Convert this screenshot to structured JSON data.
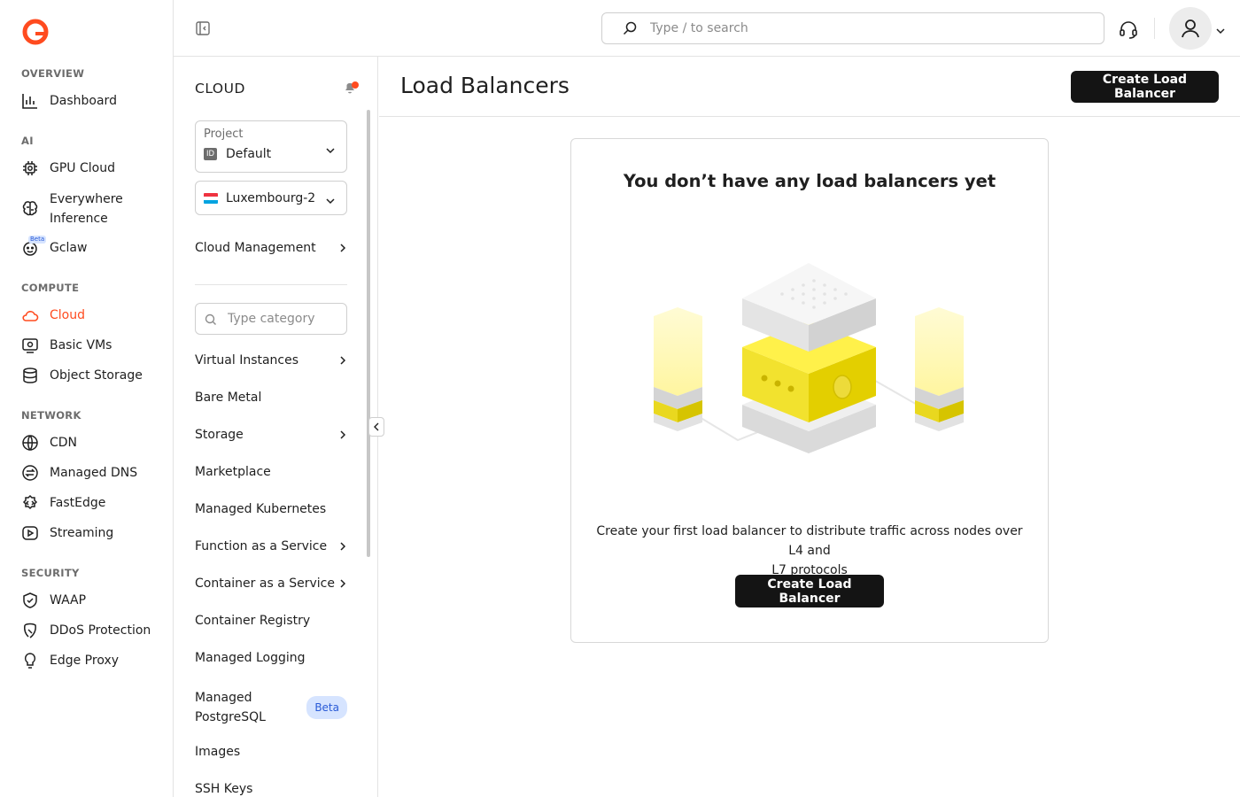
{
  "leftnav": {
    "sections": {
      "overview": "OVERVIEW",
      "ai": "AI",
      "compute": "COMPUTE",
      "network": "NETWORK",
      "security": "SECURITY"
    },
    "items": {
      "dashboard": "Dashboard",
      "gpu_cloud": "GPU Cloud",
      "everywhere_1": "Everywhere",
      "everywhere_2": "Inference",
      "gclaw": "Gclaw",
      "gclaw_badge": "Beta",
      "cloud": "Cloud",
      "basic_vms": "Basic VMs",
      "object_storage": "Object Storage",
      "cdn": "CDN",
      "managed_dns": "Managed DNS",
      "fastedge": "FastEdge",
      "streaming": "Streaming",
      "waap": "WAAP",
      "ddos": "DDoS Protection",
      "edge_proxy": "Edge Proxy"
    },
    "accent_color": "#ff4b1f"
  },
  "topbar": {
    "search_placeholder": "Type / to search"
  },
  "subnav": {
    "title": "CLOUD",
    "project_label": "Project",
    "project_badge": "ID",
    "project_value": "Default",
    "region_value": "Luxembourg-2",
    "cloud_management": "Cloud Management",
    "category_placeholder": "Type category",
    "items": {
      "virtual_instances": "Virtual Instances",
      "bare_metal": "Bare Metal",
      "storage": "Storage",
      "marketplace": "Marketplace",
      "managed_kubernetes": "Managed Kubernetes",
      "faas": "Function as a Service",
      "caas": "Container as a Service",
      "container_registry": "Container Registry",
      "managed_logging": "Managed Logging",
      "managed_pg_1": "Managed",
      "managed_pg_2": "PostgreSQL",
      "managed_pg_badge": "Beta",
      "images": "Images",
      "ssh_keys": "SSH Keys"
    }
  },
  "main": {
    "title": "Load Balancers",
    "header_button": "Create Load Balancer",
    "empty_title": "You don’t have any load balancers yet",
    "empty_desc_1": "Create your first load balancer to distribute traffic across nodes over L4 and",
    "empty_desc_2": "L7 protocols",
    "empty_button": "Create Load Balancer"
  }
}
